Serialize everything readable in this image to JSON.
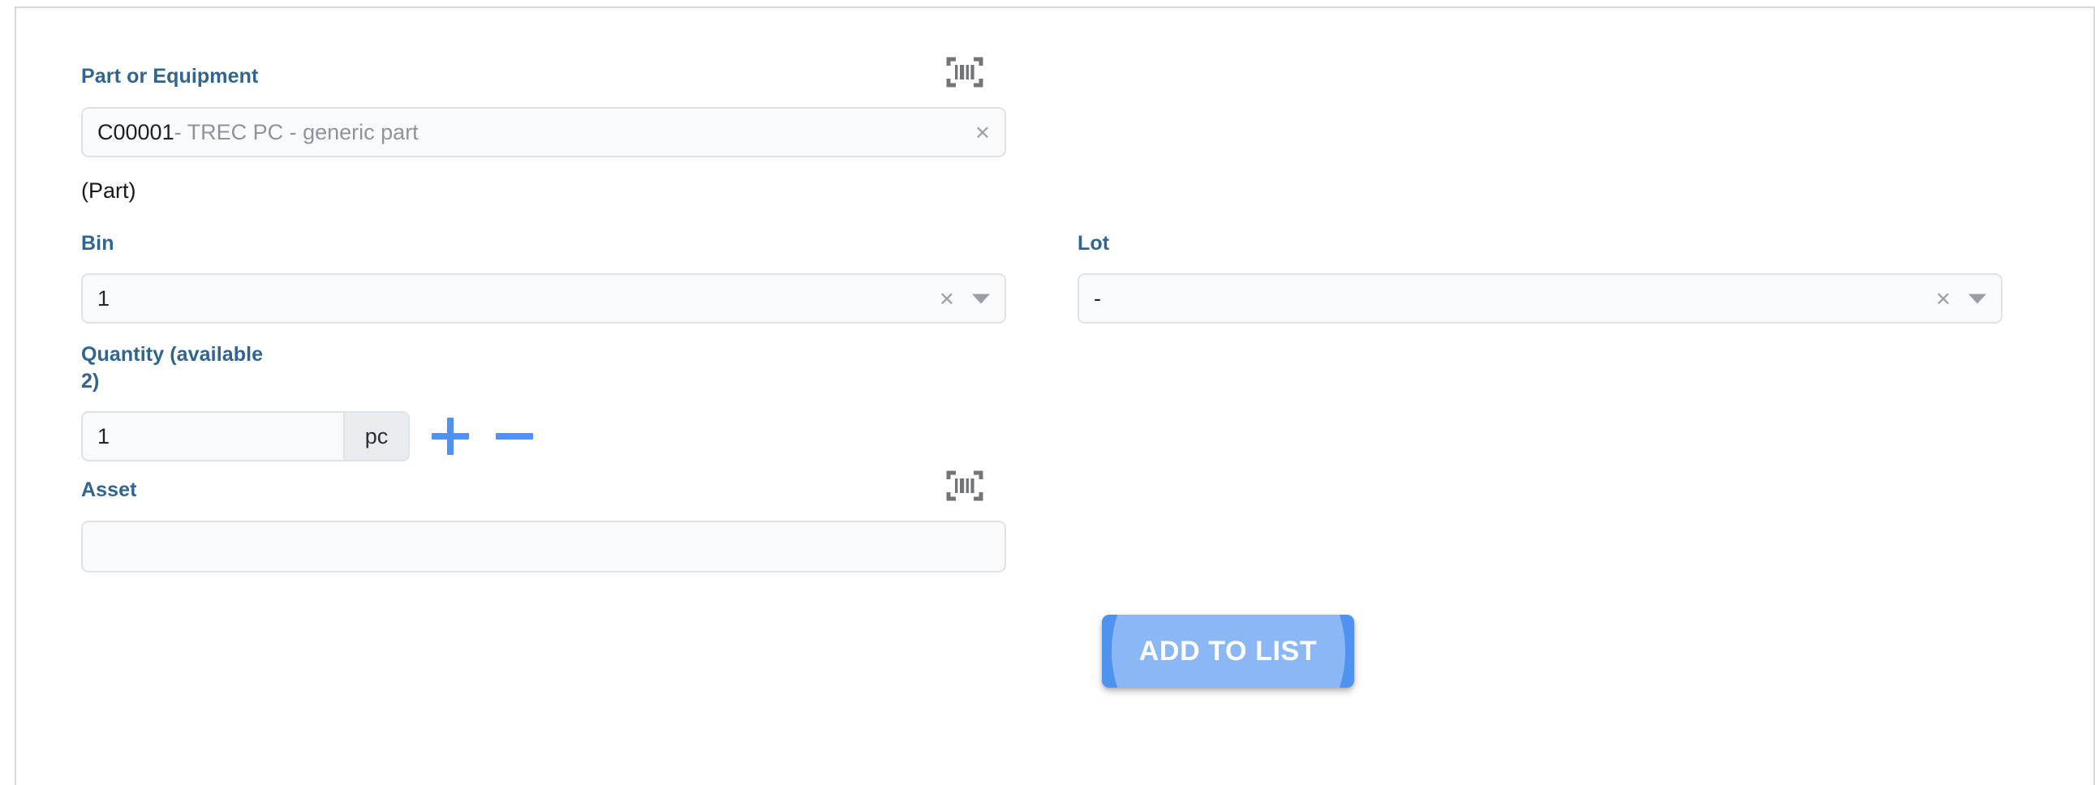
{
  "form": {
    "part": {
      "label": "Part or Equipment",
      "value_code": "C00001",
      "value_description": " - TREC PC - generic part",
      "clear_icon": "×",
      "scan_icon": "barcode-scan-icon",
      "type_note": "(Part)"
    },
    "bin": {
      "label": "Bin",
      "value": "1",
      "clear_icon": "×",
      "caret_icon": "chevron-down-icon"
    },
    "lot": {
      "label": "Lot",
      "value": "-",
      "clear_icon": "×",
      "caret_icon": "chevron-down-icon"
    },
    "quantity": {
      "label": "Quantity (available 2)",
      "available": 2,
      "value": "1",
      "unit": "pc",
      "increment_icon": "plus-icon",
      "decrement_icon": "minus-icon"
    },
    "asset": {
      "label": "Asset",
      "value": "",
      "placeholder": "",
      "scan_icon": "barcode-scan-icon"
    }
  },
  "actions": {
    "add_to_list": "ADD TO LIST"
  },
  "colors": {
    "label_blue": "#31648f",
    "accent_blue": "#4f93ef",
    "input_bg": "#f9fafb",
    "input_border": "#dfe3e8",
    "muted_text": "#8d949c",
    "panel_border": "#d6d8db"
  }
}
